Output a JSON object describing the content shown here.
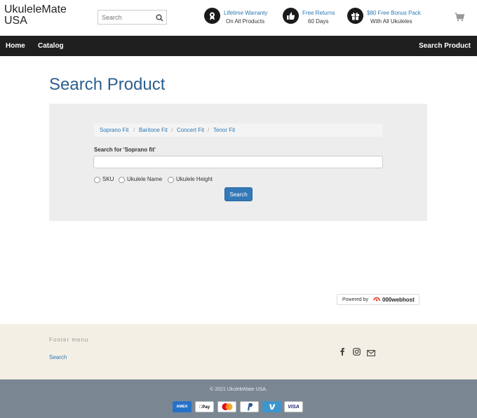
{
  "header": {
    "brand": "UkuleleMate USA",
    "search_placeholder": "Search",
    "perks": [
      {
        "icon": "award-icon",
        "title": "Lifetime Warranty",
        "subtitle": "On All Products"
      },
      {
        "icon": "thumbs-up-icon",
        "title": "Free Returns",
        "subtitle": "60 Days"
      },
      {
        "icon": "gift-icon",
        "title": "$80 Free Bonus Pack",
        "subtitle": "With All Ukuleles"
      }
    ],
    "cart_icon": "cart-icon"
  },
  "nav": {
    "items": [
      "Home",
      "Catalog"
    ],
    "right_item": "Search Product"
  },
  "main": {
    "title": "Search Product",
    "breadcrumb": [
      "Soprano Fit",
      "Baritone Fit",
      "Concert Fit",
      "Tenor Fit"
    ],
    "breadcrumb_sep": "/",
    "search_label": "Search for 'Soprano fit'",
    "search_value": "",
    "radios": [
      "SKU",
      "Ukulele Name",
      "Ukulele Height"
    ],
    "search_button": "Search"
  },
  "powered": {
    "label": "Powered by",
    "host": "000webhost"
  },
  "footer": {
    "menu_title": "Footer menu",
    "links": [
      "Search"
    ],
    "social_icons": [
      "facebook-icon",
      "instagram-icon",
      "email-icon"
    ],
    "copyright": "© 2021 UkuleleMate USA.",
    "payments": [
      "AMEX",
      "Apple Pay",
      "Mastercard",
      "PayPal",
      "Venmo",
      "VISA"
    ]
  },
  "colors": {
    "nav_bg": "#1f1f1f",
    "link": "#2a78b5",
    "title": "#2d5f8f",
    "footer_bg": "#f4efe4",
    "bottom_bg": "#7a8793",
    "button": "#3479b8"
  }
}
